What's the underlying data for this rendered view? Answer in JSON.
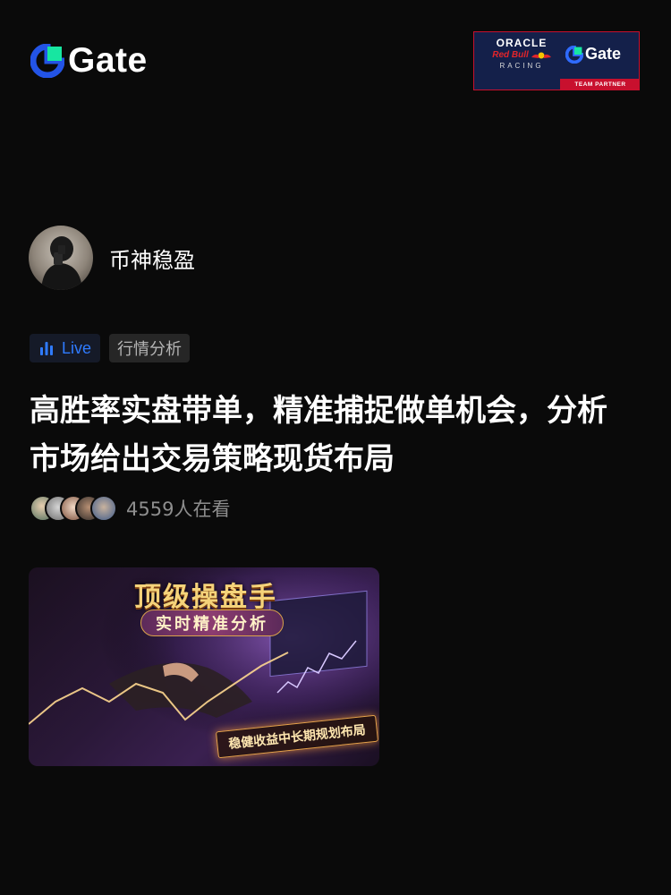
{
  "header": {
    "brand": "Gate",
    "partner": {
      "oracle": "ORACLE",
      "redbull": "Red Bull",
      "racing": "RACING",
      "gate": "Gate",
      "team_partner": "TEAM PARTNER",
      "colors": {
        "navy": "#14204a",
        "red": "#c8102e"
      }
    }
  },
  "host": {
    "name": "币神稳盈"
  },
  "tags": {
    "live": "Live",
    "category": "行情分析"
  },
  "title": "高胜率实盘带单，精准捕捉做单机会，分析市场给出交易策略现货布局",
  "viewers": {
    "count_text": "4559人在看"
  },
  "thumbnail": {
    "title": "顶级操盘手",
    "subtitle": "实时精准分析",
    "banner": "稳健收益中长期规划布局"
  },
  "colors": {
    "accent": "#2f7bff",
    "background": "#0a0a0a",
    "brand_blue": "#17e6a1"
  }
}
